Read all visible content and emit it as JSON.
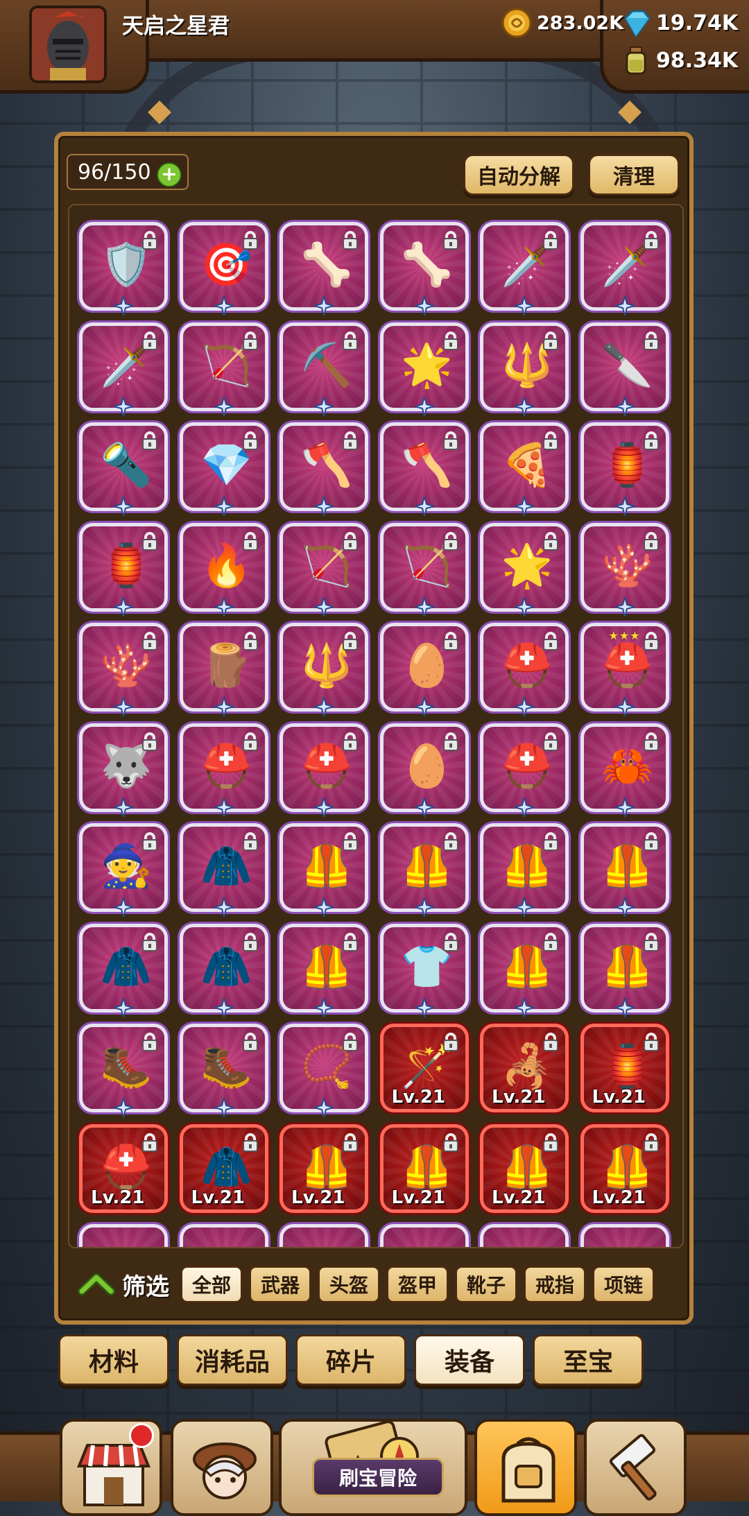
{
  "player": {
    "name": "天启之星君"
  },
  "resources": {
    "gold": "283.02K",
    "gems": "19.74K",
    "potion": "98.34K"
  },
  "inventory": {
    "capacity": "96/150"
  },
  "actions": {
    "auto_decompose": "自动分解",
    "clean": "清理"
  },
  "filter": {
    "label": "筛选",
    "tabs": [
      "全部",
      "武器",
      "头盔",
      "盔甲",
      "靴子",
      "戒指",
      "项链"
    ],
    "active": "全部"
  },
  "categories": {
    "tabs": [
      "材料",
      "消耗品",
      "碎片",
      "装备",
      "至宝"
    ],
    "active": "装备"
  },
  "bottom_nav": {
    "adventure_label": "刷宝冒险"
  },
  "items": [
    {
      "icon": "🛡️",
      "name": "golden-shield"
    },
    {
      "icon": "🎯",
      "name": "ring-amulet"
    },
    {
      "icon": "🦴",
      "name": "white-club"
    },
    {
      "icon": "🦴",
      "name": "white-club"
    },
    {
      "icon": "🗡️",
      "name": "blue-sword"
    },
    {
      "icon": "🗡️",
      "name": "blue-sword"
    },
    {
      "icon": "🗡️",
      "name": "blue-sword"
    },
    {
      "icon": "🏹",
      "name": "wood-bow"
    },
    {
      "icon": "⛏️",
      "name": "shovel"
    },
    {
      "icon": "🌟",
      "name": "star-wand"
    },
    {
      "icon": "🔱",
      "name": "golden-scepter"
    },
    {
      "icon": "🔪",
      "name": "pocket-knife"
    },
    {
      "icon": "🔦",
      "name": "crystal-staff"
    },
    {
      "icon": "💎",
      "name": "emerald-book"
    },
    {
      "icon": "🪓",
      "name": "golden-axe"
    },
    {
      "icon": "🪓",
      "name": "golden-axe"
    },
    {
      "icon": "🍕",
      "name": "pizza"
    },
    {
      "icon": "🏮",
      "name": "golden-sign"
    },
    {
      "icon": "🏮",
      "name": "golden-sign"
    },
    {
      "icon": "🔥",
      "name": "flame-sword"
    },
    {
      "icon": "🏹",
      "name": "red-bow"
    },
    {
      "icon": "🏹",
      "name": "crossbow"
    },
    {
      "icon": "🌟",
      "name": "star-wand"
    },
    {
      "icon": "🪸",
      "name": "coral-staff"
    },
    {
      "icon": "🪸",
      "name": "coral-staff"
    },
    {
      "icon": "🪵",
      "name": "dark-club"
    },
    {
      "icon": "🔱",
      "name": "golden-scepter"
    },
    {
      "icon": "🥚",
      "name": "king-egg"
    },
    {
      "icon": "⛑️",
      "name": "bunny-helmet"
    },
    {
      "icon": "⛑️",
      "name": "bunny-helmet-3star",
      "stars": "★★★"
    },
    {
      "icon": "🐺",
      "name": "wolf-helmet"
    },
    {
      "icon": "⛑️",
      "name": "red-helmet"
    },
    {
      "icon": "⛑️",
      "name": "red-helmet"
    },
    {
      "icon": "🥚",
      "name": "king-egg"
    },
    {
      "icon": "⛑️",
      "name": "knight-helmet"
    },
    {
      "icon": "🦀",
      "name": "crab-helmet"
    },
    {
      "icon": "🧙",
      "name": "wizard-hat"
    },
    {
      "icon": "🧥",
      "name": "camo-cloak"
    },
    {
      "icon": "🦺",
      "name": "gold-armor"
    },
    {
      "icon": "🦺",
      "name": "purple-armor"
    },
    {
      "icon": "🦺",
      "name": "stone-armor"
    },
    {
      "icon": "🦺",
      "name": "leather-armor"
    },
    {
      "icon": "🧥",
      "name": "red-robe"
    },
    {
      "icon": "🧥",
      "name": "red-robe"
    },
    {
      "icon": "🦺",
      "name": "purple-plate"
    },
    {
      "icon": "👕",
      "name": "white-fur"
    },
    {
      "icon": "🦺",
      "name": "gold-plate-glow"
    },
    {
      "icon": "🦺",
      "name": "gold-plate"
    },
    {
      "icon": "🥾",
      "name": "gold-boot"
    },
    {
      "icon": "🥾",
      "name": "iron-boot"
    },
    {
      "icon": "📿",
      "name": "amulet"
    },
    {
      "icon": "🪄",
      "name": "bone-staff",
      "level": "Lv.21"
    },
    {
      "icon": "🦂",
      "name": "scythe",
      "level": "Lv.21"
    },
    {
      "icon": "🏮",
      "name": "golden-sign",
      "level": "Lv.21"
    },
    {
      "icon": "⛑️",
      "name": "red-helmet",
      "level": "Lv.21"
    },
    {
      "icon": "🧥",
      "name": "fur-robe",
      "level": "Lv.21"
    },
    {
      "icon": "🦺",
      "name": "dark-armor",
      "level": "Lv.21"
    },
    {
      "icon": "🦺",
      "name": "dark-armor",
      "level": "Lv.21"
    },
    {
      "icon": "🦺",
      "name": "purple-plate",
      "level": "Lv.21"
    },
    {
      "icon": "🦺",
      "name": "purple-plate",
      "level": "Lv.21"
    },
    {
      "icon": "",
      "name": "partial"
    },
    {
      "icon": "",
      "name": "partial"
    },
    {
      "icon": "",
      "name": "partial"
    },
    {
      "icon": "",
      "name": "partial"
    },
    {
      "icon": "",
      "name": "partial"
    },
    {
      "icon": "",
      "name": "partial"
    }
  ]
}
